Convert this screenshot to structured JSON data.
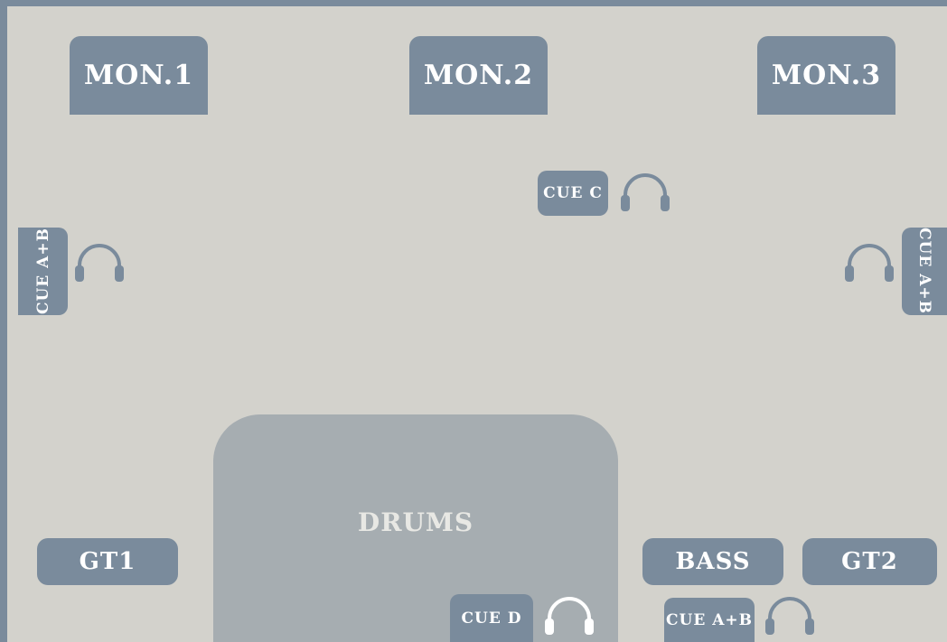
{
  "monitors": {
    "mon1": "MON.1",
    "mon2": "MON.2",
    "mon3": "MON.3"
  },
  "instruments": {
    "drums": "DRUMS",
    "gt1": "GT1",
    "bass": "BASS",
    "gt2": "GT2"
  },
  "cues": {
    "cue_c": "CUE C",
    "cue_ab_left": "CUE A+B",
    "cue_ab_right": "CUE A+B",
    "cue_d": "CUE D",
    "cue_ab_bottom": "CUE A+B"
  },
  "icons": {
    "headphones": "headphones-icon"
  },
  "colors": {
    "stage": "#d3d2cc",
    "block": "#7a8b9c",
    "drums": "#a6adb1",
    "border": "#7a8b9c"
  }
}
